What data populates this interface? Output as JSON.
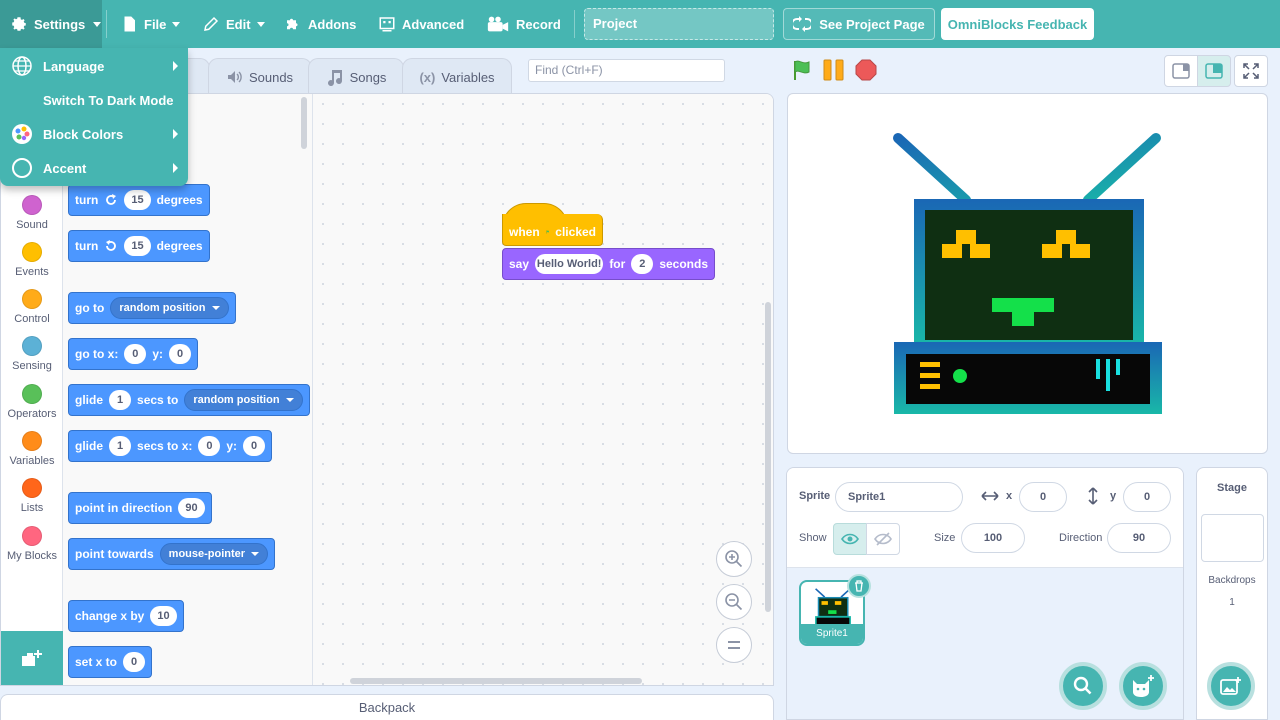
{
  "menubar": {
    "settings": "Settings",
    "file": "File",
    "edit": "Edit",
    "addons": "Addons",
    "advanced": "Advanced",
    "record": "Record",
    "project_title": "Project",
    "see_project_page": "See Project Page",
    "feedback": "OmniBlocks Feedback"
  },
  "settings_menu": {
    "items": [
      {
        "label": "Language",
        "icon": "globe-icon",
        "submenu": true
      },
      {
        "label": "Switch To Dark Mode",
        "icon": "moon-icon",
        "submenu": false
      },
      {
        "label": "Block Colors",
        "icon": "palette-icon",
        "submenu": true
      },
      {
        "label": "Accent",
        "icon": "circle-icon",
        "submenu": true
      }
    ]
  },
  "tabs": {
    "sounds": "Sounds",
    "songs": "Songs",
    "variables": "Variables"
  },
  "find": {
    "placeholder": "Find (Ctrl+F)"
  },
  "categories": [
    {
      "label": "Sound",
      "color": "#cf63cf"
    },
    {
      "label": "Events",
      "color": "#ffbf00"
    },
    {
      "label": "Control",
      "color": "#ffab19"
    },
    {
      "label": "Sensing",
      "color": "#5cb1d6"
    },
    {
      "label": "Operators",
      "color": "#59c059"
    },
    {
      "label": "Variables",
      "color": "#ff8c1a"
    },
    {
      "label": "Lists",
      "color": "#ff661a"
    },
    {
      "label": "My Blocks",
      "color": "#ff6680"
    }
  ],
  "palette": {
    "turn_right": {
      "w1": "turn",
      "val": "15",
      "w2": "degrees"
    },
    "turn_left": {
      "w1": "turn",
      "val": "15",
      "w2": "degrees"
    },
    "go_to": {
      "w1": "go to",
      "dd": "random position"
    },
    "go_to_xy": {
      "w1": "go to x:",
      "x": "0",
      "w2": "y:",
      "y": "0"
    },
    "glide_to": {
      "w1": "glide",
      "val": "1",
      "w2": "secs to",
      "dd": "random position"
    },
    "glide_xy": {
      "w1": "glide",
      "val": "1",
      "w2": "secs to x:",
      "x": "0",
      "w3": "y:",
      "y": "0"
    },
    "point_dir": {
      "w1": "point in direction",
      "val": "90"
    },
    "point_towards": {
      "w1": "point towards",
      "dd": "mouse-pointer"
    },
    "change_x": {
      "w1": "change x by",
      "val": "10"
    },
    "set_x": {
      "w1": "set x to",
      "val": "0"
    }
  },
  "script": {
    "hat": {
      "w1": "when",
      "w2": "clicked"
    },
    "say": {
      "w1": "say",
      "msg": "Hello World!",
      "w2": "for",
      "val": "2",
      "w3": "seconds"
    }
  },
  "backpack": "Backpack",
  "sprite_info": {
    "sprite_label": "Sprite",
    "sprite_name": "Sprite1",
    "x_label": "x",
    "x": "0",
    "y_label": "y",
    "y": "0",
    "show_label": "Show",
    "size_label": "Size",
    "size": "100",
    "direction_label": "Direction",
    "direction": "90"
  },
  "sprites": [
    {
      "name": "Sprite1"
    }
  ],
  "stage_pane": {
    "title": "Stage",
    "backdrops_label": "Backdrops",
    "backdrops_count": "1"
  },
  "colors": {
    "accent": "#46b5b1",
    "motion": "#4c97ff",
    "events": "#ffbf00",
    "looks": "#9966ff"
  }
}
